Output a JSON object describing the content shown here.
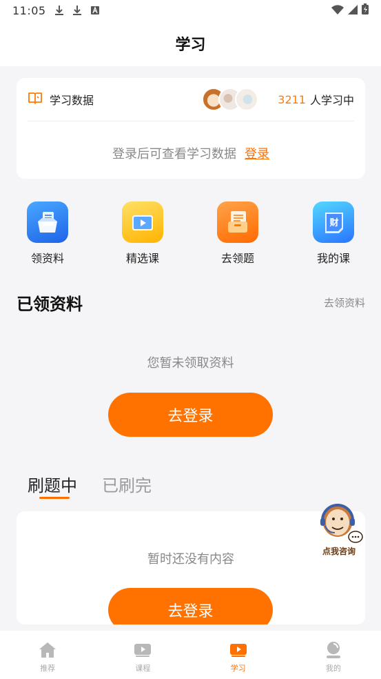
{
  "status_bar": {
    "time": "11:05"
  },
  "header": {
    "title": "学习"
  },
  "study_data": {
    "title": "学习数据",
    "learners_count": "3211",
    "learners_label": "人学习中",
    "login_hint": "登录后可查看学习数据",
    "login_link": "登录"
  },
  "entries": [
    {
      "label": "领资料",
      "icon": "materials-icon"
    },
    {
      "label": "精选课",
      "icon": "featured-course-icon"
    },
    {
      "label": "去领题",
      "icon": "get-questions-icon"
    },
    {
      "label": "我的课",
      "icon": "my-course-icon"
    }
  ],
  "materials_section": {
    "title": "已领资料",
    "more": "去领资料",
    "empty_text": "您暂未领取资料",
    "button": "去登录"
  },
  "tabs": [
    {
      "label": "刷题中",
      "active": true
    },
    {
      "label": "已刷完",
      "active": false
    }
  ],
  "practice_card": {
    "empty_text": "暂时还没有内容",
    "button": "去登录"
  },
  "mascot": {
    "label": "点我咨询"
  },
  "bottom_nav": [
    {
      "label": "推荐",
      "icon": "home-icon"
    },
    {
      "label": "课程",
      "icon": "course-icon"
    },
    {
      "label": "学习",
      "icon": "study-icon",
      "active": true
    },
    {
      "label": "我的",
      "icon": "profile-icon"
    }
  ],
  "colors": {
    "accent": "#ff7000",
    "background": "#f5f5f7"
  }
}
